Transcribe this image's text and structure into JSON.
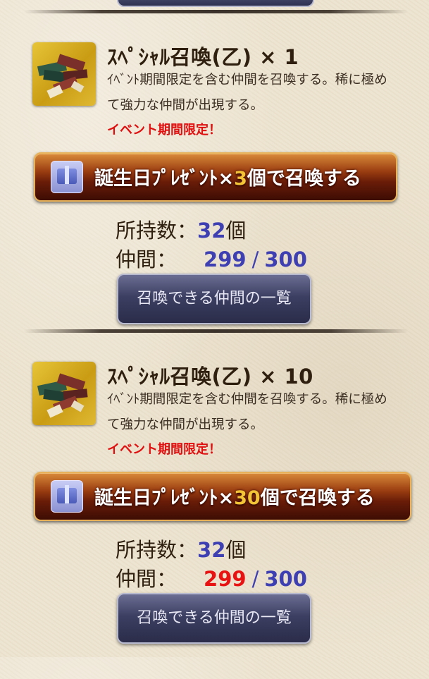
{
  "sections": [
    {
      "title": "ｽﾍﾟｼｬﾙ召喚(乙) × 1",
      "description": "ｲﾍﾞﾝﾄ期間限定を含む仲間を召喚する。稀に極めて強力な仲間が出現する。",
      "limited_label": "イベント期間限定！",
      "summon_button": {
        "prefix": "誕生日ﾌﾟﾚｾﾞﾝﾄ×",
        "count": "3",
        "suffix": "個で召喚する"
      },
      "owned_label": "所持数：",
      "owned_value": "32",
      "owned_unit": "個",
      "companions_label": "仲間：",
      "companions_current": "299",
      "companions_max": "300",
      "companions_current_color": "#3e3fb2",
      "list_button_label": "召喚できる仲間の一覧"
    },
    {
      "title": "ｽﾍﾟｼｬﾙ召喚(乙) × 10",
      "description": "ｲﾍﾞﾝﾄ期間限定を含む仲間を召喚する。稀に極めて強力な仲間が出現する。",
      "limited_label": "イベント期間限定！",
      "summon_button": {
        "prefix": "誕生日ﾌﾟﾚｾﾞﾝﾄ×",
        "count": "30",
        "suffix": "個で召喚する"
      },
      "owned_label": "所持数：",
      "owned_value": "32",
      "owned_unit": "個",
      "companions_label": "仲間：",
      "companions_current": "299",
      "companions_max": "300",
      "companions_current_color": "#e81212",
      "list_button_label": "召喚できる仲間の一覧"
    }
  ],
  "icons": {
    "item_thumb": "books-pile-icon",
    "button_icon": "gift-box-icon"
  },
  "colors": {
    "accent_number": "#3e3fb2",
    "warning": "#e01010",
    "button_gold": "#f4c437"
  }
}
